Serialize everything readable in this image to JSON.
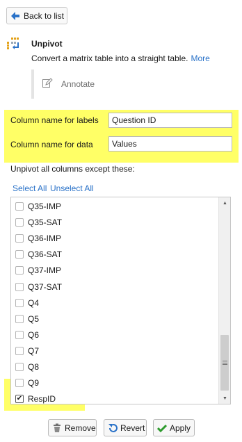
{
  "back_button": {
    "label": "Back to list",
    "icon": "arrow-left-icon"
  },
  "tool": {
    "icon": "unpivot-icon",
    "title": "Unpivot",
    "description": "Convert a matrix table into a straight table.",
    "more_link": "More"
  },
  "annotate": {
    "label": "Annotate",
    "icon": "pencil-icon"
  },
  "fields": {
    "labels": {
      "label": "Column name for labels",
      "value": "Question ID"
    },
    "data": {
      "label": "Column name for data",
      "value": "Values"
    }
  },
  "section_label": "Unpivot all columns except these:",
  "select_all": "Select All",
  "unselect_all": "Unselect All",
  "columns": [
    {
      "name": "Q35-IMP",
      "checked": false
    },
    {
      "name": "Q35-SAT",
      "checked": false
    },
    {
      "name": "Q36-IMP",
      "checked": false
    },
    {
      "name": "Q36-SAT",
      "checked": false
    },
    {
      "name": "Q37-IMP",
      "checked": false
    },
    {
      "name": "Q37-SAT",
      "checked": false
    },
    {
      "name": "Q4",
      "checked": false
    },
    {
      "name": "Q5",
      "checked": false
    },
    {
      "name": "Q6",
      "checked": false
    },
    {
      "name": "Q7",
      "checked": false
    },
    {
      "name": "Q8",
      "checked": false
    },
    {
      "name": "Q9",
      "checked": false
    },
    {
      "name": "RespID",
      "checked": true
    }
  ],
  "buttons": {
    "remove": "Remove",
    "revert": "Revert",
    "apply": "Apply"
  },
  "colors": {
    "highlight": "#ffff66",
    "link": "#2a72c8",
    "back_arrow": "#2a72c8",
    "apply_icon": "#2e9b2e",
    "remove_icon": "#6e6e6e",
    "revert_icon": "#2a72c8"
  }
}
